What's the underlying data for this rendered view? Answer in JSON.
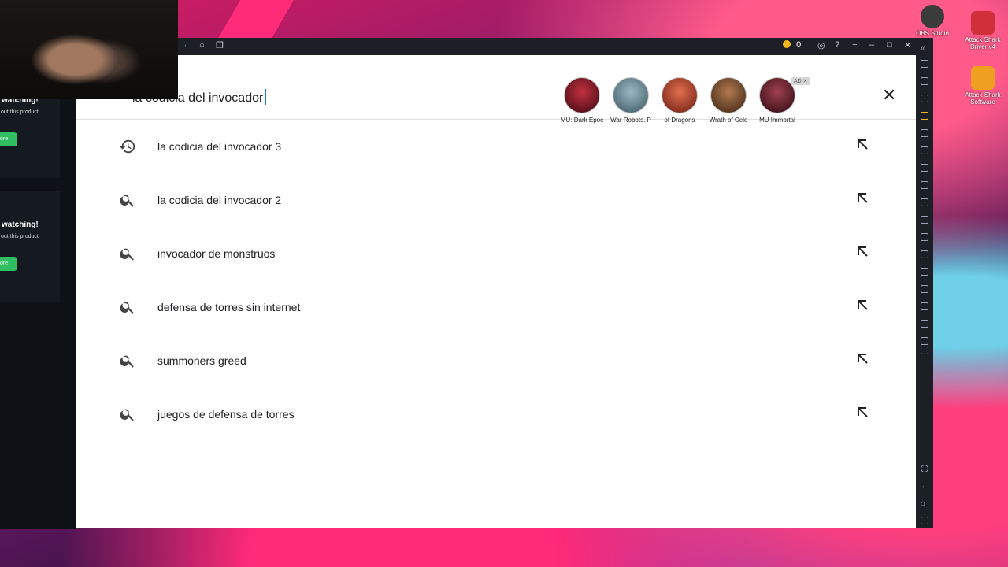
{
  "desktop": {
    "icons": [
      {
        "label": "OBS Studio",
        "color": "#3b3b3b"
      },
      {
        "label": "Attack Shark Driver v4",
        "color": "#d0303a"
      },
      {
        "label": "Attack Shark Software",
        "color": "#f0a020"
      }
    ]
  },
  "stream_page": {
    "cards": [
      {
        "title": "watching!",
        "subtitle": "out this product",
        "button": "ore"
      },
      {
        "title": "watching!",
        "subtitle": "out this product",
        "button": "ore"
      }
    ]
  },
  "emulator": {
    "coin_count": "0",
    "accent_color": "#f1b81c"
  },
  "search": {
    "query": "la codicia del invocador",
    "ad_label": "AD"
  },
  "promoted_games": [
    {
      "name": "MU: Dark Epoc",
      "color": "#7a1020"
    },
    {
      "name": "War Robots. P",
      "color": "#5e7a86"
    },
    {
      "name": "of Dragons",
      "color": "#b0402a"
    },
    {
      "name": "Wrath of Cele",
      "color": "#7a4a2a"
    },
    {
      "name": "MU Immortal",
      "color": "#5a1a22"
    }
  ],
  "suggestions": [
    {
      "text": "la codicia del invocador 3",
      "icon": "history-icon"
    },
    {
      "text": "la codicia del invocador 2",
      "icon": "search-icon"
    },
    {
      "text": "invocador de monstruos",
      "icon": "search-icon"
    },
    {
      "text": "defensa de torres sin internet",
      "icon": "search-icon"
    },
    {
      "text": "summoners greed",
      "icon": "search-icon"
    },
    {
      "text": "juegos de defensa de torres",
      "icon": "search-icon"
    }
  ]
}
